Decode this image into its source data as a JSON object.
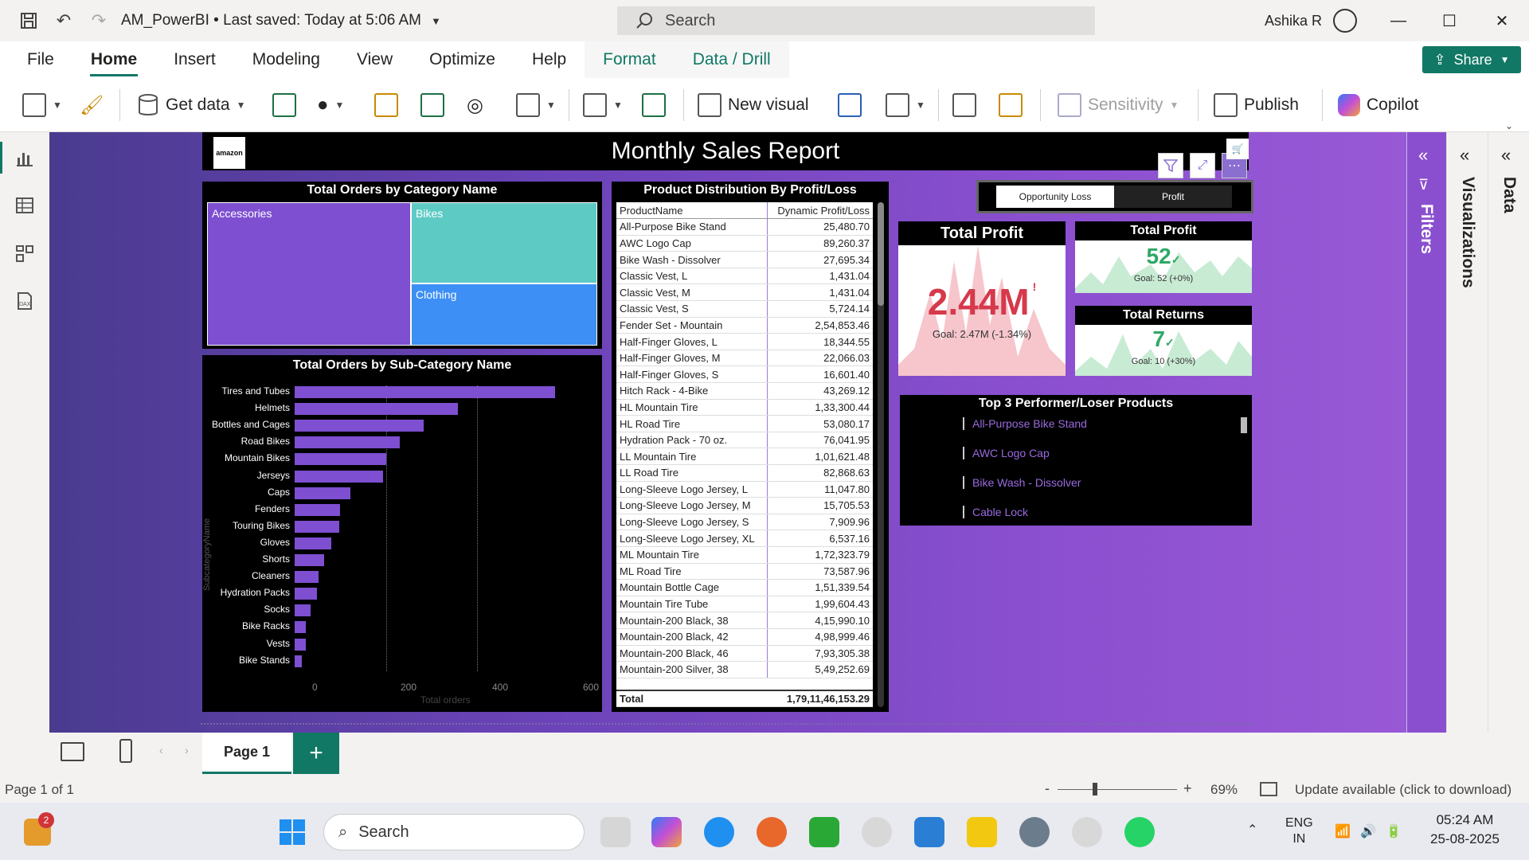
{
  "app": {
    "file_title": "AM_PowerBI",
    "save_status": "• Last saved: Today at 5:06 AM",
    "search_placeholder": "Search",
    "user_name": "Ashika R"
  },
  "ribbon_tabs": [
    "File",
    "Home",
    "Insert",
    "Modeling",
    "View",
    "Optimize",
    "Help",
    "Format",
    "Data / Drill"
  ],
  "share_label": "Share",
  "toolbar": {
    "get_data": "Get data",
    "new_visual": "New visual",
    "sensitivity": "Sensitivity",
    "publish": "Publish",
    "copilot": "Copilot"
  },
  "report": {
    "title": "Monthly Sales Report",
    "logo_text": "amazon"
  },
  "treemap": {
    "title": "Total Orders by Category Name",
    "cells": [
      "Accessories",
      "Bikes",
      "Clothing"
    ],
    "colors": [
      "#7e4fd1",
      "#5ecac4",
      "#3d8ff5"
    ]
  },
  "subcat_chart": {
    "title": "Total Orders by Sub-Category Name",
    "ylabel": "SubcategoryName",
    "xlabel": "Total orders",
    "ticks": [
      "0",
      "200",
      "400",
      "600"
    ]
  },
  "chart_data": {
    "type": "bar",
    "title": "Total Orders by Sub-Category Name",
    "xlabel": "Total orders",
    "ylabel": "SubcategoryName",
    "xlim": [
      0,
      600
    ],
    "categories": [
      "Tires and Tubes",
      "Helmets",
      "Bottles and Cages",
      "Road Bikes",
      "Mountain Bikes",
      "Jerseys",
      "Caps",
      "Fenders",
      "Touring Bikes",
      "Gloves",
      "Shorts",
      "Cleaners",
      "Hydration Packs",
      "Socks",
      "Bike Racks",
      "Vests",
      "Bike Stands"
    ],
    "values": [
      570,
      357,
      283,
      230,
      200,
      193,
      122,
      100,
      98,
      80,
      64,
      53,
      48,
      35,
      25,
      24,
      16
    ]
  },
  "product_table": {
    "title": "Product Distribution By Profit/Loss",
    "headers": [
      "ProductName",
      "Dynamic Profit/Loss"
    ],
    "rows": [
      [
        "All-Purpose Bike Stand",
        "25,480.70"
      ],
      [
        "AWC Logo Cap",
        "89,260.37"
      ],
      [
        "Bike Wash - Dissolver",
        "27,695.34"
      ],
      [
        "Classic Vest, L",
        "1,431.04"
      ],
      [
        "Classic Vest, M",
        "1,431.04"
      ],
      [
        "Classic Vest, S",
        "5,724.14"
      ],
      [
        "Fender Set - Mountain",
        "2,54,853.46"
      ],
      [
        "Half-Finger Gloves, L",
        "18,344.55"
      ],
      [
        "Half-Finger Gloves, M",
        "22,066.03"
      ],
      [
        "Half-Finger Gloves, S",
        "16,601.40"
      ],
      [
        "Hitch Rack - 4-Bike",
        "43,269.12"
      ],
      [
        "HL Mountain Tire",
        "1,33,300.44"
      ],
      [
        "HL Road Tire",
        "53,080.17"
      ],
      [
        "Hydration Pack - 70 oz.",
        "76,041.95"
      ],
      [
        "LL Mountain Tire",
        "1,01,621.48"
      ],
      [
        "LL Road Tire",
        "82,868.63"
      ],
      [
        "Long-Sleeve Logo Jersey, L",
        "11,047.80"
      ],
      [
        "Long-Sleeve Logo Jersey, M",
        "15,705.53"
      ],
      [
        "Long-Sleeve Logo Jersey, S",
        "7,909.96"
      ],
      [
        "Long-Sleeve Logo Jersey, XL",
        "6,537.16"
      ],
      [
        "ML Mountain Tire",
        "1,72,323.79"
      ],
      [
        "ML Road Tire",
        "73,587.96"
      ],
      [
        "Mountain Bottle Cage",
        "1,51,339.54"
      ],
      [
        "Mountain Tire Tube",
        "1,99,604.43"
      ],
      [
        "Mountain-200 Black, 38",
        "4,15,990.10"
      ],
      [
        "Mountain-200 Black, 42",
        "4,98,999.46"
      ],
      [
        "Mountain-200 Black, 46",
        "7,93,305.38"
      ],
      [
        "Mountain-200 Silver, 38",
        "5,49,252.69"
      ]
    ],
    "total_label": "Total",
    "total_value": "1,79,11,46,153.29"
  },
  "toggle": {
    "options": [
      "Opportunity Loss",
      "Profit"
    ],
    "selected": "Profit"
  },
  "kpi_profit": {
    "title": "Total Profit",
    "value": "2.44M",
    "alert": "!",
    "goal": "Goal: 2.47M (-1.34%)",
    "value_color": "#d6394b"
  },
  "kpi_small_profit": {
    "title": "Total Profit",
    "value": "52",
    "goal": "Goal: 52 (+0%)",
    "value_color": "#2fa866"
  },
  "kpi_returns": {
    "title": "Total Returns",
    "value": "7",
    "goal": "Goal: 10 (+30%)",
    "value_color": "#2fa866"
  },
  "top_list": {
    "title": "Top 3 Performer/Loser Products",
    "items": [
      "All-Purpose Bike Stand",
      "AWC Logo Cap",
      "Bike Wash - Dissolver",
      "Cable Lock"
    ]
  },
  "right_panes": {
    "filters": "Filters",
    "visualizations": "Visualizations",
    "data": "Data"
  },
  "pages": {
    "current": "Page 1",
    "add": "+"
  },
  "status": {
    "page_info": "Page 1 of 1",
    "zoom": "69%",
    "update": "Update available (click to download)"
  },
  "taskbar": {
    "search": "Search",
    "lang1": "ENG",
    "lang2": "IN",
    "time": "05:24 AM",
    "date": "25-08-2025",
    "badge": "2"
  }
}
